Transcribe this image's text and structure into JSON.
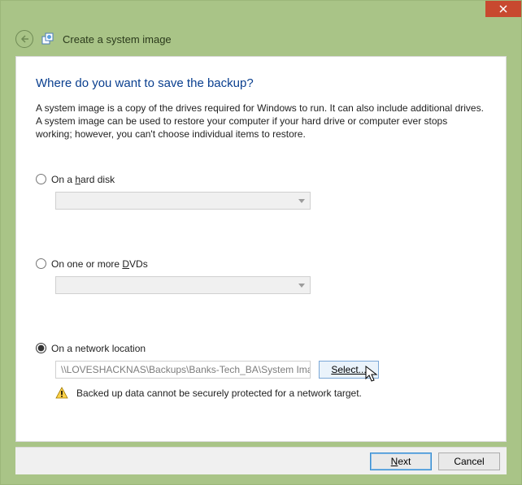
{
  "window": {
    "title": "Create a system image"
  },
  "main": {
    "heading": "Where do you want to save the backup?",
    "description": "A system image is a copy of the drives required for Windows to run. It can also include additional drives. A system image can be used to restore your computer if your hard drive or computer ever stops working; however, you can't choose individual items to restore."
  },
  "options": {
    "hard_disk": {
      "label_pre": "On a ",
      "label_hot": "h",
      "label_post": "ard disk",
      "selected": false
    },
    "dvds": {
      "label_pre": "On one or more ",
      "label_hot": "D",
      "label_post": "VDs",
      "selected": false
    },
    "network": {
      "label": "On a network location",
      "selected": true,
      "path": "\\\\LOVESHACKNAS\\Backups\\Banks-Tech_BA\\System Image",
      "select_button": "Select...",
      "warning": "Backed up data cannot be securely protected for a network target."
    }
  },
  "footer": {
    "next_hot": "N",
    "next_post": "ext",
    "cancel": "Cancel"
  }
}
